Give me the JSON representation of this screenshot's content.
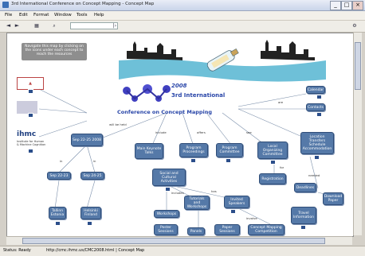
{
  "window": {
    "title": "3rd International Conference on Concept Mapping - Concept Map",
    "minimize": "_",
    "maximize": "□",
    "close": "×"
  },
  "menu": [
    "File",
    "Edit",
    "Format",
    "Window",
    "Tools",
    "Help"
  ],
  "toolbar": {
    "back": "◄",
    "forward": "►",
    "address": "",
    "go": "|›"
  },
  "canvas": {
    "info_text": "Navigate this map by clicking on the icons under each concept to reach the resources",
    "banner": {
      "prefix": "CM",
      "tagline": "2008",
      "line1": "3rd International",
      "line2": "Conference on Concept Mapping"
    },
    "logos": {
      "ihmc": "ihmc",
      "ihmc_sub": "Institute for Human & Machine Cognition",
      "other": ""
    },
    "nodes": {
      "n_top_right_1": "Calendar",
      "n_top_right_2": "Contacts",
      "n_mid_right": "Location Transfers Schedule Accommodation",
      "n_sep_2225": "Sep 22-25 2008",
      "n_sep_2223": "Sep 22-23",
      "n_sep_2425": "Sep 24-25",
      "n_tallinn": "Tallinn Estonia",
      "n_helsinki": "Helsinki Finland",
      "n_main_keynote": "Main Keynote Talks",
      "n_program": "Program Proceedings",
      "n_program_committee": "Program Committee",
      "n_local": "Local Organizing Committee",
      "n_social": "Social and Cultural Activities",
      "n_registration": "Registration",
      "n_deadlines": "Deadlines",
      "n_tutorials": "Tutorials and Workshops",
      "n_invited": "Invited Speakers",
      "n_sponsors": "Sponsors",
      "n_download": "Download Paper",
      "n_workshops": "Workshops",
      "n_poster": "Poster Sessions",
      "n_panels": "Panels",
      "n_paper_sessions": "Paper Sessions",
      "n_concept_mapping": "Concept Mapping Competition",
      "n_travel": "Travel Information",
      "n_more": "More"
    },
    "link_labels": {
      "l1": "will be held",
      "l2": "in",
      "l3": "in",
      "l4": "include",
      "l5": "offers",
      "l6": "see",
      "l7": "are",
      "l8": "includes",
      "l9": "has",
      "l10": "involve",
      "l11": "for",
      "l12": "needed"
    }
  },
  "status": {
    "left": "Status: Ready",
    "right": "http://cmc.ihmc.us/CMC2008.html | Concept Map"
  },
  "colors": {
    "node_fill": "#5579a8",
    "node_border": "#2f4d78",
    "water": "#6ec0d8",
    "banner_text": "#2845a8"
  }
}
